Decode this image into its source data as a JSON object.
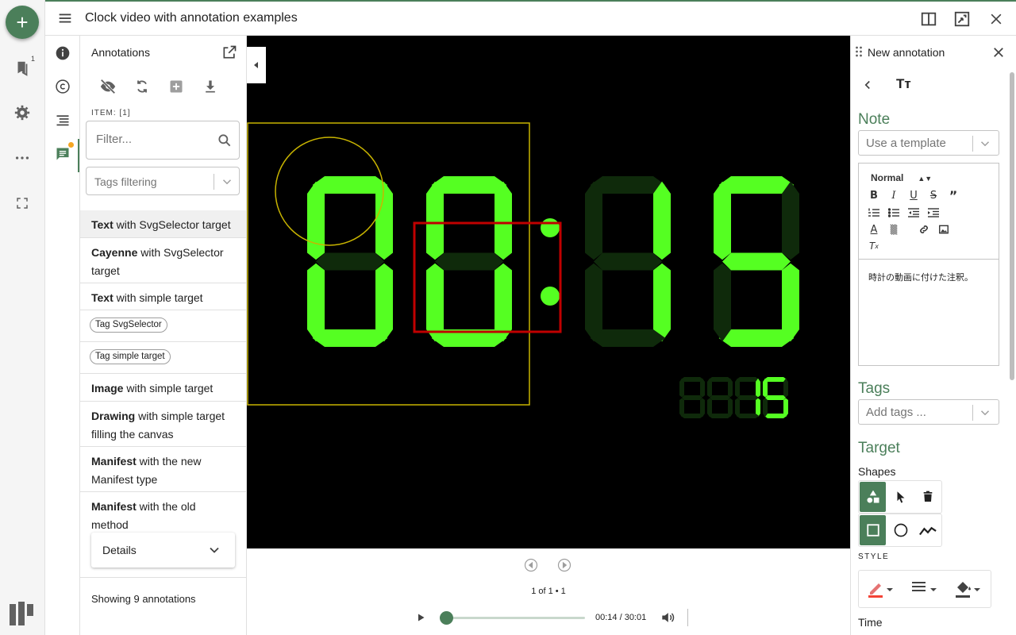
{
  "window": {
    "title": "Clock video with annotation examples"
  },
  "rail": {
    "add_label": "+",
    "bookmark_count": "1"
  },
  "annotations_panel": {
    "title": "Annotations",
    "item_label": "ITEM: [1]",
    "filter_placeholder": "Filter...",
    "tags_filter_placeholder": "Tags filtering",
    "items": [
      {
        "kind": "Text",
        "rest": " with SvgSelector target"
      },
      {
        "kind": "Cayenne",
        "rest": " with SvgSelector target"
      },
      {
        "kind": "Text",
        "rest": " with simple target"
      },
      {
        "tag": "Tag SvgSelector"
      },
      {
        "tag": "Tag simple target"
      },
      {
        "kind": "Image",
        "rest": " with simple target"
      },
      {
        "kind": "Drawing",
        "rest": " with simple target filling the canvas"
      },
      {
        "kind": "Manifest",
        "rest": " with the new Manifest type"
      },
      {
        "kind": "Manifest",
        "rest": " with the old method"
      }
    ],
    "details_label": "Details",
    "showing_text": "Showing 9 annotations"
  },
  "player": {
    "pager_text": "1 of 1 • 1",
    "time_text": "00:14 / 30:01",
    "progress_fraction": 0.0078
  },
  "clock_display": {
    "main_digits": "00:15",
    "sub_digits": "15"
  },
  "new_annotation": {
    "title": "New annotation",
    "text_icon": "Tт",
    "note_heading": "Note",
    "template_placeholder": "Use a template",
    "format_label": "Normal",
    "note_text": "時計の動画に付けた注釈。",
    "tags_heading": "Tags",
    "tags_placeholder": "Add tags ...",
    "target_heading": "Target",
    "shapes_label": "Shapes",
    "style_label": "STYLE",
    "time_label": "Time"
  },
  "colors": {
    "accent": "#4b7f5a",
    "segment_on": "#55ff22",
    "segment_off": "#0f2a0b",
    "yellow_shape": "#c8b400",
    "red_shape": "#c00000"
  }
}
